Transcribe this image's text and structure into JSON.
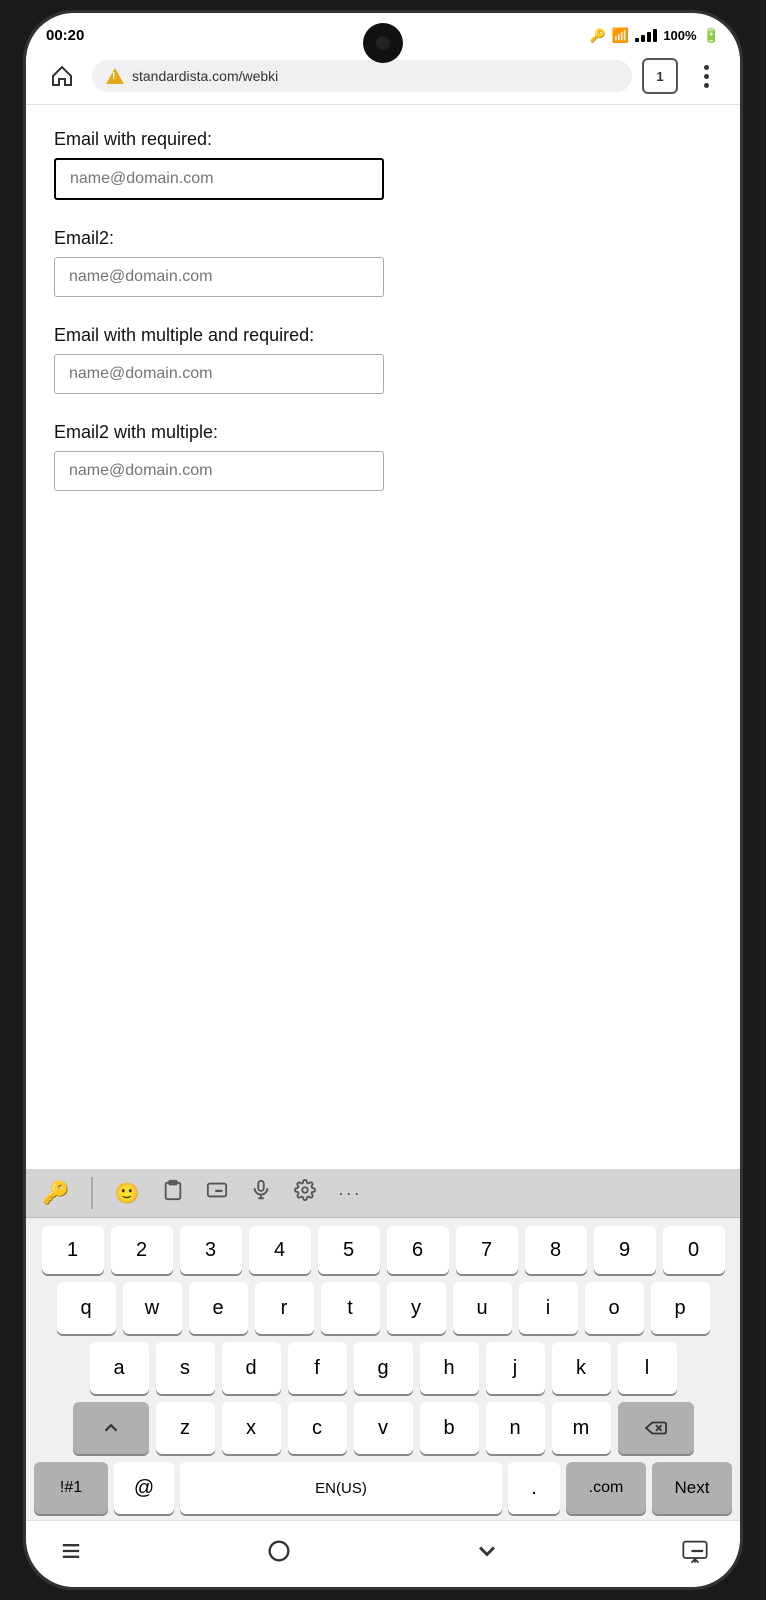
{
  "statusBar": {
    "time": "00:20",
    "battery": "100%",
    "tabs": "1"
  },
  "navBar": {
    "url": "standardista.com/webki",
    "tabs": "1"
  },
  "form": {
    "field1": {
      "label": "Email with required:",
      "placeholder": "name@domain.com",
      "state": "focused"
    },
    "field2": {
      "label": "Email2:",
      "placeholder": "name@domain.com"
    },
    "field3": {
      "label": "Email with multiple and required:",
      "placeholder": "name@domain.com"
    },
    "field4": {
      "label": "Email2 with multiple:",
      "placeholder": "name@domain.com"
    }
  },
  "keyboard": {
    "toolbar": {
      "keyIcon": "🔑",
      "icons": [
        "😊",
        "📋",
        "⌨",
        "🎤",
        "⚙",
        "···"
      ]
    },
    "numberRow": [
      "1",
      "2",
      "3",
      "4",
      "5",
      "6",
      "7",
      "8",
      "9",
      "0"
    ],
    "row1": [
      "q",
      "w",
      "e",
      "r",
      "t",
      "y",
      "u",
      "i",
      "o",
      "p"
    ],
    "row2": [
      "a",
      "s",
      "d",
      "f",
      "g",
      "h",
      "j",
      "k",
      "l"
    ],
    "row3": [
      "z",
      "x",
      "c",
      "v",
      "b",
      "n",
      "m"
    ],
    "bottomRow": {
      "symbols": "!#1",
      "at": "@",
      "space": "EN(US)",
      "period": ".",
      "dotcom": ".com",
      "next": "Next"
    }
  },
  "bottomNav": {
    "back": "|||",
    "home": "○",
    "down": "∨",
    "keyboard": "⌨"
  }
}
